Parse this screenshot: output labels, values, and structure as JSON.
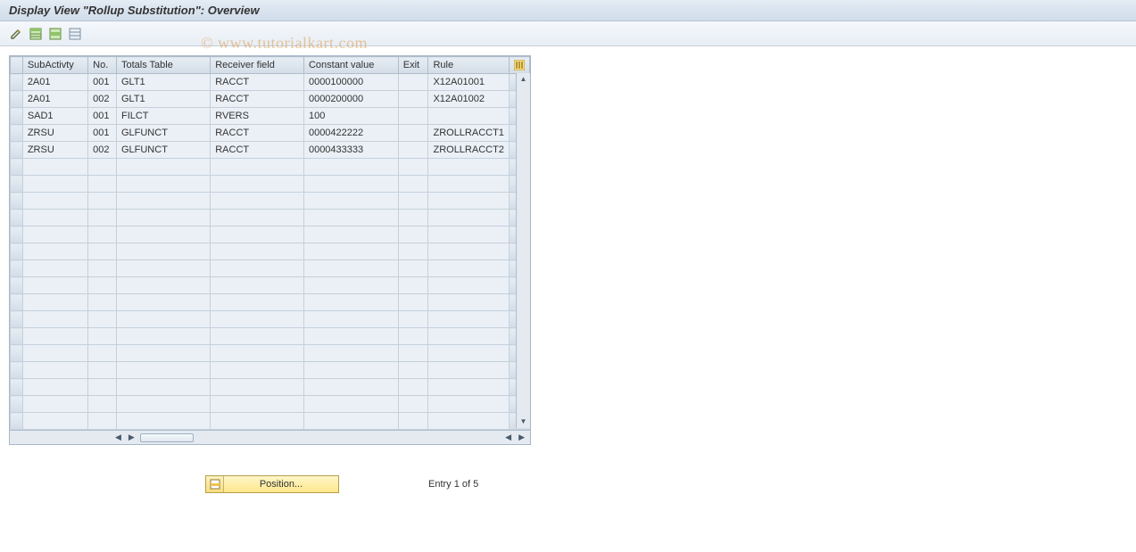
{
  "title": "Display View \"Rollup Substitution\": Overview",
  "watermark": "© www.tutorialkart.com",
  "toolbar": {
    "edit_label": "Display/Change",
    "select_all_label": "Select all",
    "select_block_label": "Deselect all",
    "deselect_label": "Print"
  },
  "columns": {
    "subactivity": "SubActivty",
    "no": "No.",
    "totals_table": "Totals Table",
    "receiver_field": "Receiver field",
    "constant_value": "Constant value",
    "exit": "Exit",
    "rule": "Rule"
  },
  "rows": [
    {
      "subactivity": "2A01",
      "no": "001",
      "totals_table": "GLT1",
      "receiver_field": "RACCT",
      "constant_value": "0000100000",
      "exit": "",
      "rule": "X12A01001"
    },
    {
      "subactivity": "2A01",
      "no": "002",
      "totals_table": "GLT1",
      "receiver_field": "RACCT",
      "constant_value": "0000200000",
      "exit": "",
      "rule": "X12A01002"
    },
    {
      "subactivity": "SAD1",
      "no": "001",
      "totals_table": "FILCT",
      "receiver_field": "RVERS",
      "constant_value": "100",
      "exit": "",
      "rule": ""
    },
    {
      "subactivity": "ZRSU",
      "no": "001",
      "totals_table": "GLFUNCT",
      "receiver_field": "RACCT",
      "constant_value": "0000422222",
      "exit": "",
      "rule": "ZROLLRACCT1"
    },
    {
      "subactivity": "ZRSU",
      "no": "002",
      "totals_table": "GLFUNCT",
      "receiver_field": "RACCT",
      "constant_value": "0000433333",
      "exit": "",
      "rule": "ZROLLRACCT2"
    }
  ],
  "empty_rows_count": 16,
  "footer": {
    "position_label": "Position...",
    "entry_text": "Entry 1 of 5"
  }
}
